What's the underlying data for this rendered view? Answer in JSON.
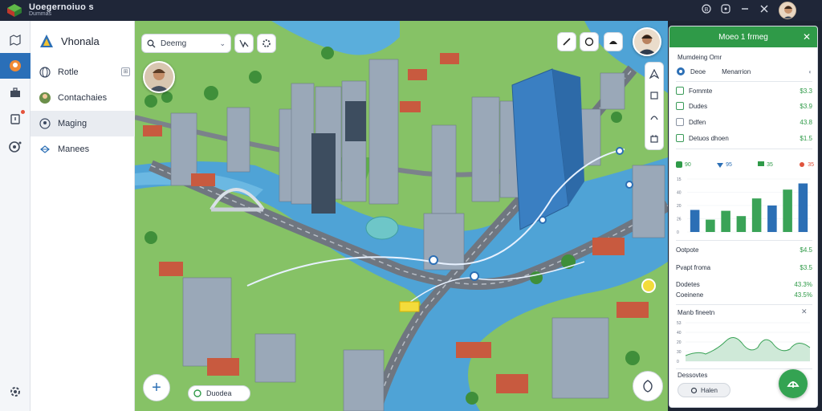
{
  "window": {
    "title": "Uoegernoiuo s",
    "subtitle": "Dummas",
    "buttons": [
      "help-icon",
      "info-icon",
      "minimize-icon",
      "close-icon"
    ]
  },
  "rail": {
    "items": [
      "map-outline-icon",
      "location-pin-icon",
      "briefcase-icon",
      "alert-icon",
      "camera-icon",
      "settings-icon"
    ],
    "active_index": 1
  },
  "sidebar": {
    "brand": "Vhonala",
    "items": [
      {
        "label": "Rotle",
        "icon": "globe-icon"
      },
      {
        "label": "Contachaies",
        "icon": "avatar-icon"
      },
      {
        "label": "Maging",
        "icon": "people-icon",
        "selected": true
      },
      {
        "label": "Manees",
        "icon": "crosshair-icon"
      }
    ]
  },
  "map": {
    "search_value": "Deemg",
    "layer_label": "Duodea"
  },
  "details": {
    "header": "Moeo 1 frmeg",
    "section_title": "Mumdeing Omr",
    "summary_name": "Deoe",
    "summary_value": "Menarrion",
    "rows": [
      {
        "label": "Fommte",
        "value": "$3.3"
      },
      {
        "label": "Dudes",
        "value": "$3.9"
      },
      {
        "label": "Ddfen",
        "value": "43.8"
      },
      {
        "label": "Detuos dhoen",
        "value": "$1.5"
      }
    ],
    "stat_pills": [
      {
        "label": "90",
        "color": "#2f9a48"
      },
      {
        "label": "95",
        "color": "#2c6fb5"
      },
      {
        "label": "35",
        "color": "#2f9a48"
      },
      {
        "label": "35",
        "color": "#e0533c"
      }
    ],
    "chart_axis": [
      "15",
      "40",
      "20",
      "26",
      "0"
    ],
    "bar_values": [
      25,
      14,
      24,
      18,
      38,
      30,
      48,
      55
    ],
    "bar_colors": [
      "#2c6fb5",
      "#3aa357",
      "#3aa357",
      "#3aa357",
      "#3aa357",
      "#2c6fb5",
      "#3aa357",
      "#2c6fb5"
    ],
    "metrics": [
      {
        "label": "Ootpote",
        "value": "$4.5"
      },
      {
        "label": "Pvapt froma",
        "value": "$3.5"
      },
      {
        "label": "Dodetes",
        "value": "43.3%"
      },
      {
        "label": "Coeinene",
        "value": "43.5%"
      }
    ],
    "trend_title": "Manb fineetn",
    "trend_axis": [
      "53",
      "40",
      "20",
      "30",
      "0"
    ],
    "footer_title": "Dessovtes",
    "footer_button": "Halen"
  }
}
